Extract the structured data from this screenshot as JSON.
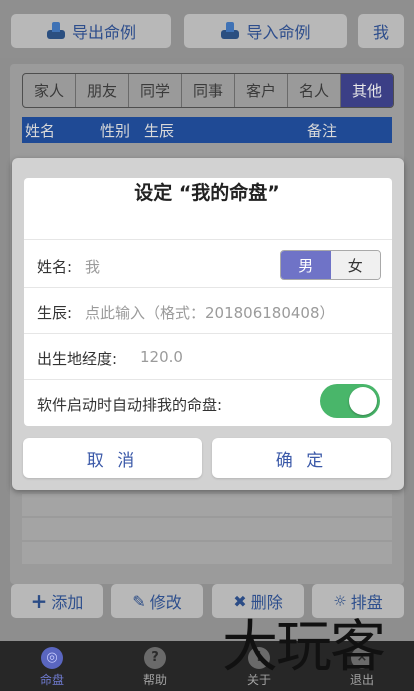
{
  "top_toolbar": {
    "export_label": "导出命例",
    "import_label": "导入命例",
    "me_label": "我"
  },
  "tabs": [
    {
      "label": "家人"
    },
    {
      "label": "朋友"
    },
    {
      "label": "同学"
    },
    {
      "label": "同事"
    },
    {
      "label": "客户"
    },
    {
      "label": "名人"
    },
    {
      "label": "其他",
      "active": true
    }
  ],
  "table": {
    "headers": [
      "姓名",
      "性别",
      "生辰",
      "备注"
    ]
  },
  "dialog": {
    "title": "设定 “我的命盘”",
    "name_label": "姓名:",
    "name_value": "我",
    "gender_male": "男",
    "gender_female": "女",
    "gender_selected": "男",
    "birth_label": "生辰:",
    "birth_placeholder": "点此输入（格式：201806180408）",
    "longitude_label": "出生地经度:",
    "longitude_value": "120.0",
    "auto_label": "软件启动时自动排我的命盘:",
    "auto_enabled": true,
    "cancel_label": "取 消",
    "ok_label": "确 定"
  },
  "bottom_toolbar": {
    "add_label": "添加",
    "edit_label": "修改",
    "delete_label": "删除",
    "arrange_label": "排盘"
  },
  "bottom_nav": [
    {
      "label": "命盘",
      "icon": "target-icon",
      "active": true
    },
    {
      "label": "帮助",
      "icon": "help-icon"
    },
    {
      "label": "关于",
      "icon": "info-icon"
    },
    {
      "label": "退出",
      "icon": "exit-icon"
    }
  ],
  "watermark": "大玩客",
  "colors": {
    "accent": "#6f73c7",
    "toggle_on": "#49b66a",
    "header_blue": "#1f4a95",
    "button_text": "#3b59a8"
  }
}
